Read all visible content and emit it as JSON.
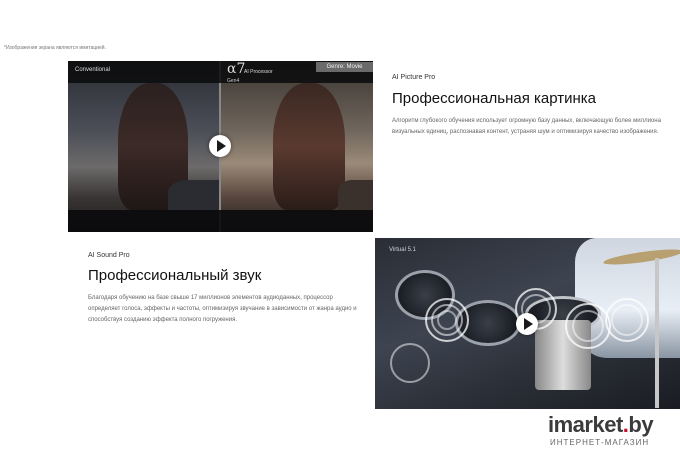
{
  "disclaimer": "*Изображения экрана являются имитацией.",
  "video1": {
    "left_label": "Conventional",
    "right_logo": "α7",
    "right_logo_sub": "Gen4",
    "right_label": "AI Processor",
    "genre_tag": "Genre: Movie"
  },
  "section1": {
    "subtitle": "AI Picture Pro",
    "title": "Профессиональная картинка",
    "description": "Алгоритм глубокого обучения использует огромную базу данных, включающую более миллиона визуальных единиц, распознавая контент, устраняя шум и оптимизируя качество изображения."
  },
  "section2": {
    "subtitle": "AI Sound Pro",
    "title": "Профессиональный звук",
    "description": "Благодаря обучению на базе свыше 17 миллионов элементов аудиоданных, процессор определяет голоса, эффекты и частоты, оптимизируя звучание в зависимости от жанра аудио и способствуя созданию эффекта полного погружения."
  },
  "video2": {
    "label": "Virtual 5.1"
  },
  "watermark": {
    "brand_main": "imarket",
    "brand_dot": ".",
    "brand_tld": "by",
    "tagline": "ИНТЕРНЕТ-МАГАЗИН"
  },
  "colors": {
    "title_text": "#111111",
    "body_text": "#666666",
    "watermark_accent": "#c8102e"
  }
}
